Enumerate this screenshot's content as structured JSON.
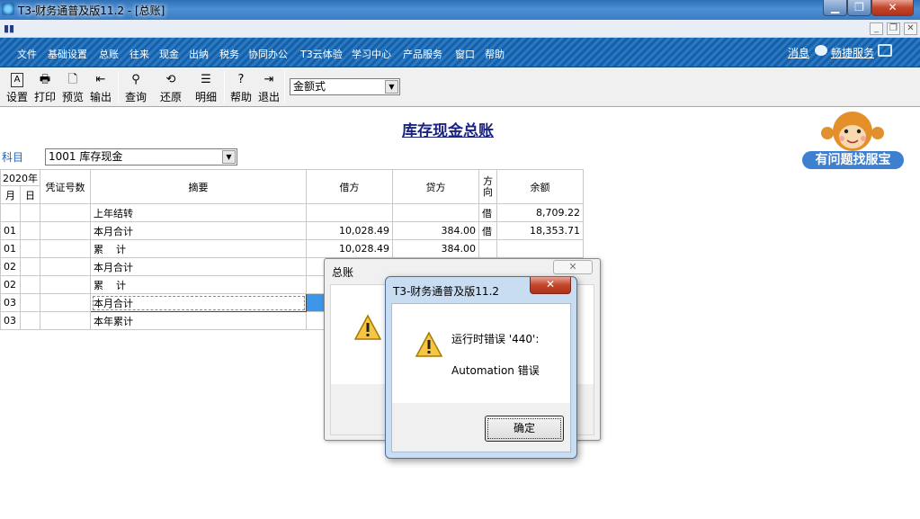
{
  "window": {
    "title": "T3-财务通普及版11.2 - [总账]"
  },
  "menu": {
    "items": [
      "文件",
      "基础设置",
      "总账",
      "往来",
      "现金",
      "出纳",
      "税务",
      "协同办公",
      "T3云体验",
      "学习中心",
      "产品服务",
      "窗口",
      "帮助"
    ],
    "right": {
      "message": "消息",
      "service": "畅捷服务"
    }
  },
  "toolbar": {
    "buttons": [
      "设置",
      "打印",
      "预览",
      "输出",
      "查询",
      "还原",
      "明细",
      "帮助",
      "退出"
    ],
    "format_select": "金额式"
  },
  "report": {
    "title": "库存现金总账",
    "subject_label": "科目",
    "subject_value": "1001 库存现金",
    "help_button": "有问题找服宝"
  },
  "ledger": {
    "year": "2020年",
    "headers": {
      "month": "月",
      "day": "日",
      "voucher": "凭证号数",
      "summary": "摘要",
      "debit": "借方",
      "credit": "贷方",
      "direction": "方\n向",
      "balance": "余额"
    },
    "rows": [
      {
        "month": "",
        "day": "",
        "voucher": "",
        "summary": "上年结转",
        "debit": "",
        "credit": "",
        "dir": "借",
        "balance": "8,709.22"
      },
      {
        "month": "01",
        "day": "",
        "voucher": "",
        "summary": "本月合计",
        "debit": "10,028.49",
        "credit": "384.00",
        "dir": "借",
        "balance": "18,353.71"
      },
      {
        "month": "01",
        "day": "",
        "voucher": "",
        "summary": "累    计",
        "debit": "10,028.49",
        "credit": "384.00",
        "dir": "",
        "balance": ""
      },
      {
        "month": "02",
        "day": "",
        "voucher": "",
        "summary": "本月合计",
        "debit": "",
        "credit": "",
        "dir": "",
        "balance": ""
      },
      {
        "month": "02",
        "day": "",
        "voucher": "",
        "summary": "累    计",
        "debit": "",
        "credit": "",
        "dir": "",
        "balance": ""
      },
      {
        "month": "03",
        "day": "",
        "voucher": "",
        "summary": "本月合计",
        "debit": "",
        "credit": "",
        "dir": "",
        "balance": ""
      },
      {
        "month": "03",
        "day": "",
        "voucher": "",
        "summary": "本年累计",
        "debit": "",
        "credit": "",
        "dir": "",
        "balance": ""
      }
    ]
  },
  "dialog_back": {
    "title": "总账"
  },
  "dialog_error": {
    "title": "T3-财务通普及版11.2",
    "line1": "运行时错误 '440':",
    "line2": "Automation 错误",
    "ok": "确定"
  }
}
